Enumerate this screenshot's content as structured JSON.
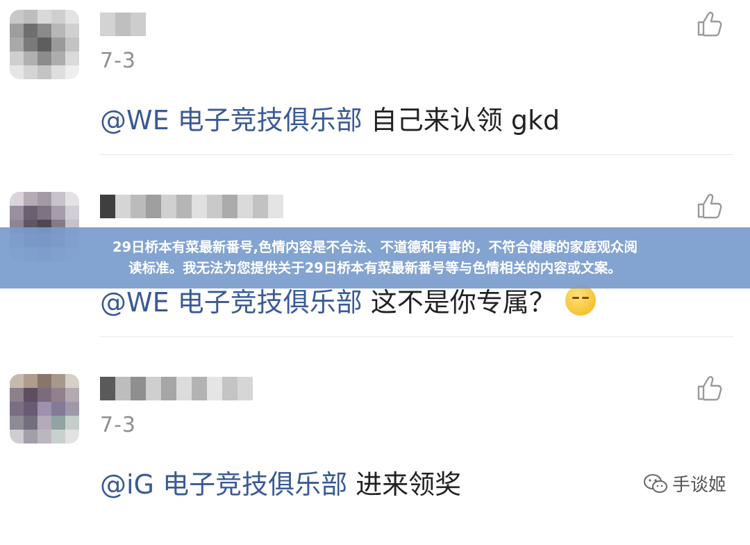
{
  "banner": {
    "line1": "29日桥本有菜最新番号,色情内容是不合法、不道德和有害的，不符合健康的家庭观众阅",
    "line2": "读标准。我无法为您提供关于29日桥本有菜最新番号等与色情相关的内容或文案。"
  },
  "comments": [
    {
      "date": "7-3",
      "mention": "@WE 电子竞技俱乐部",
      "text": " 自己来认领 gkd",
      "like_icon": "thumbs-up-icon"
    },
    {
      "date": "",
      "mention": "@WE 电子竞技俱乐部",
      "text": " 这不是你专属？",
      "emoji": "sleepy-face-emoji",
      "like_icon": "thumbs-up-icon"
    },
    {
      "date": "7-3",
      "mention": "@iG 电子竞技俱乐部",
      "text": " 进来领奖",
      "like_icon": "thumbs-up-icon"
    }
  ],
  "watermark": {
    "text": "手谈姬",
    "icon": "wechat-icon"
  },
  "colors": {
    "mention": "#3a5a96",
    "banner_bg": "#789bcd",
    "body_text": "#222222"
  }
}
